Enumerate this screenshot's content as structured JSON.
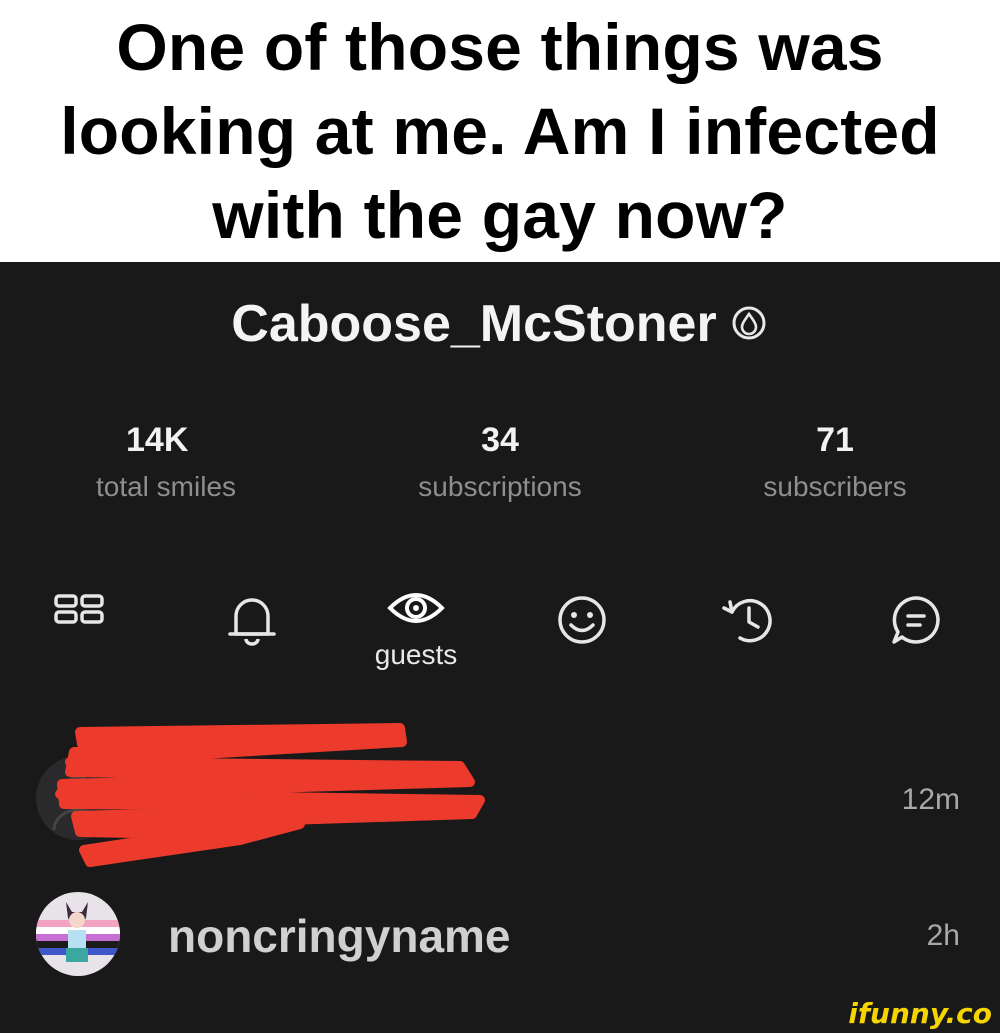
{
  "caption": "One of those things was looking at me. Am I infected with the gay now?",
  "profile": {
    "username": "Caboose_McStoner",
    "badge_icon": "drop-icon"
  },
  "stats": [
    {
      "value": "14K",
      "label": "total smiles"
    },
    {
      "value": "34",
      "label": "subscriptions"
    },
    {
      "value": "71",
      "label": "subscribers"
    }
  ],
  "tabs": {
    "items": [
      "grid-icon",
      "bell-icon",
      "eye-icon",
      "smile-icon",
      "history-icon",
      "chat-icon"
    ],
    "active_label": "guests"
  },
  "guests": [
    {
      "name": "",
      "time": "12m",
      "redacted": true
    },
    {
      "name": "noncringyname",
      "time": "2h"
    }
  ],
  "watermark": "ifunny.co",
  "colors": {
    "background": "#19191a",
    "redaction": "#ec3a2c",
    "watermark": "#f5d400"
  }
}
